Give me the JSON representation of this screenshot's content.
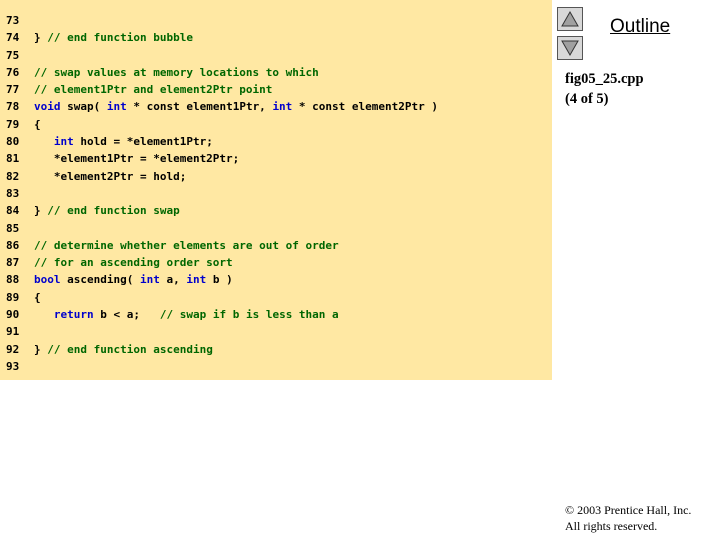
{
  "sidebar": {
    "outline_label": "Outline",
    "file_name": "fig05_25.cpp",
    "page_indicator": "(4 of 5)",
    "nav_up_icon": "triangle-up-icon",
    "nav_down_icon": "triangle-down-icon"
  },
  "code": {
    "lines": [
      {
        "num": "73",
        "tokens": []
      },
      {
        "num": "74",
        "tokens": [
          {
            "t": "} ",
            "k": "code"
          },
          {
            "t": "// end function bubble",
            "k": "comment"
          }
        ]
      },
      {
        "num": "75",
        "tokens": []
      },
      {
        "num": "76",
        "tokens": [
          {
            "t": "// swap values at memory locations to which",
            "k": "comment"
          }
        ]
      },
      {
        "num": "77",
        "tokens": [
          {
            "t": "// element1Ptr and element2Ptr point",
            "k": "comment"
          }
        ]
      },
      {
        "num": "78",
        "tokens": [
          {
            "t": "void",
            "k": "keyword"
          },
          {
            "t": " swap( ",
            "k": "code"
          },
          {
            "t": "int",
            "k": "keyword"
          },
          {
            "t": " * const element1Ptr, ",
            "k": "code"
          },
          {
            "t": "int",
            "k": "keyword"
          },
          {
            "t": " * const element2Ptr )",
            "k": "code"
          }
        ]
      },
      {
        "num": "79",
        "tokens": [
          {
            "t": "{",
            "k": "code"
          }
        ]
      },
      {
        "num": "80",
        "tokens": [
          {
            "t": "   ",
            "k": "code"
          },
          {
            "t": "int",
            "k": "keyword"
          },
          {
            "t": " hold = *element1Ptr;",
            "k": "code"
          }
        ]
      },
      {
        "num": "81",
        "tokens": [
          {
            "t": "   *element1Ptr = *element2Ptr;",
            "k": "code"
          }
        ]
      },
      {
        "num": "82",
        "tokens": [
          {
            "t": "   *element2Ptr = hold;",
            "k": "code"
          }
        ]
      },
      {
        "num": "83",
        "tokens": []
      },
      {
        "num": "84",
        "tokens": [
          {
            "t": "} ",
            "k": "code"
          },
          {
            "t": "// end function swap",
            "k": "comment"
          }
        ]
      },
      {
        "num": "85",
        "tokens": []
      },
      {
        "num": "86",
        "tokens": [
          {
            "t": "// determine whether elements are out of order",
            "k": "comment"
          }
        ]
      },
      {
        "num": "87",
        "tokens": [
          {
            "t": "// for an ascending order sort",
            "k": "comment"
          }
        ]
      },
      {
        "num": "88",
        "tokens": [
          {
            "t": "bool",
            "k": "keyword"
          },
          {
            "t": " ascending( ",
            "k": "code"
          },
          {
            "t": "int",
            "k": "keyword"
          },
          {
            "t": " a, ",
            "k": "code"
          },
          {
            "t": "int",
            "k": "keyword"
          },
          {
            "t": " b )",
            "k": "code"
          }
        ]
      },
      {
        "num": "89",
        "tokens": [
          {
            "t": "{",
            "k": "code"
          }
        ]
      },
      {
        "num": "90",
        "tokens": [
          {
            "t": "   ",
            "k": "code"
          },
          {
            "t": "return",
            "k": "keyword"
          },
          {
            "t": " b < a;   ",
            "k": "code"
          },
          {
            "t": "// swap if b is less than a",
            "k": "comment"
          }
        ]
      },
      {
        "num": "91",
        "tokens": []
      },
      {
        "num": "92",
        "tokens": [
          {
            "t": "} ",
            "k": "code"
          },
          {
            "t": "// end function ascending",
            "k": "comment"
          }
        ]
      },
      {
        "num": "93",
        "tokens": []
      }
    ]
  },
  "footer": {
    "copyright_line1": "© 2003 Prentice Hall, Inc.",
    "copyright_line2": "All rights reserved."
  },
  "colors": {
    "panel_background": "#ffe8a3",
    "comment": "#006600",
    "keyword": "#0000cc",
    "code": "#000000"
  }
}
